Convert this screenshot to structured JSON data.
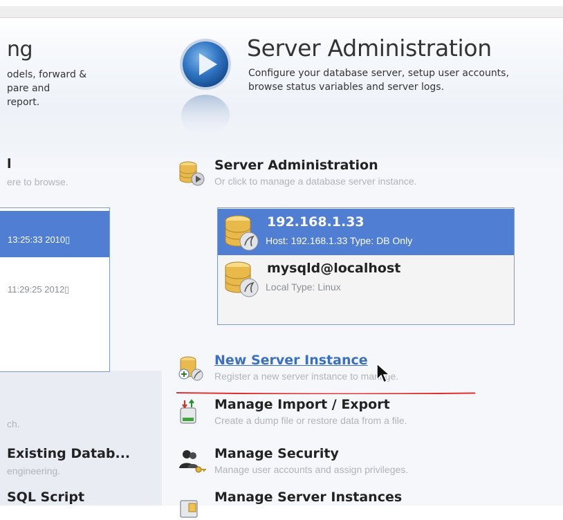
{
  "left_column": {
    "title_fragment": "ng",
    "desc_lines": [
      "odels, forward &",
      "pare and",
      "report."
    ],
    "section_heading_fragment": "l",
    "section_sub_fragment": "ere to browse.",
    "connection_rows": [
      "13:25:33 2010▯",
      "11:29:25 2012▯"
    ],
    "search_fragment": "ch.",
    "existing_db_title": "Existing Datab...",
    "existing_db_sub": "engineering.",
    "sql_script_title": "SQL Script"
  },
  "server_admin": {
    "title": "Server Administration",
    "description": "Configure your database server, setup user accounts, browse status variables and server logs.",
    "header_entry": {
      "title": "Server Administration",
      "subtitle": "Or click to manage a database server instance."
    },
    "instances": [
      {
        "name": "192.168.1.33",
        "details": "Host: 192.168.1.33  Type: DB Only",
        "selected": true
      },
      {
        "name": "mysqld@localhost",
        "details": "Local  Type: Linux",
        "selected": false
      }
    ],
    "actions": [
      {
        "title": "New Server Instance",
        "subtitle": "Register a new server instance to manage.",
        "icon": "new-instance-icon"
      },
      {
        "title": "Manage Import / Export",
        "subtitle": "Create a dump file or restore data from a file.",
        "icon": "import-export-icon"
      },
      {
        "title": "Manage Security",
        "subtitle": "Manage user accounts and assign privileges.",
        "icon": "security-icon"
      },
      {
        "title": "Manage Server Instances",
        "subtitle": "",
        "icon": "server-instances-icon"
      }
    ]
  },
  "colors": {
    "selection": "#4f7ed2",
    "link": "#3a6fc4",
    "annotation_line": "#e03030"
  }
}
